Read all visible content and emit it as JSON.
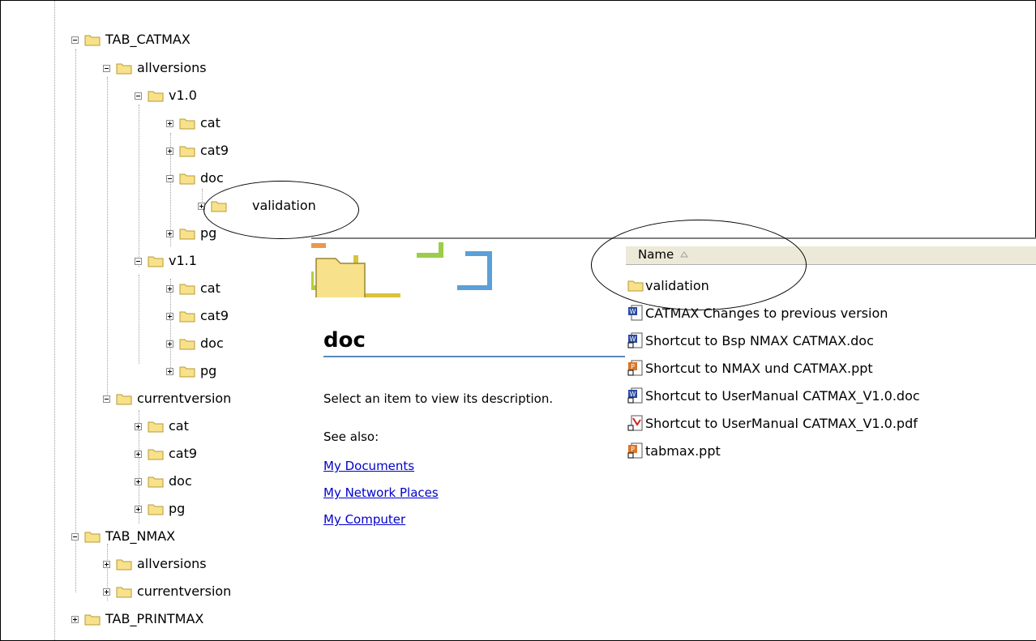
{
  "tree": {
    "nodes": [
      {
        "label": "TAB_CATMAX",
        "expanded": true
      },
      {
        "label": "allversions",
        "expanded": true
      },
      {
        "label": "v1.0",
        "expanded": true
      },
      {
        "label": "cat",
        "expanded": false
      },
      {
        "label": "cat9",
        "expanded": false
      },
      {
        "label": "doc",
        "expanded": true
      },
      {
        "label": "validation",
        "expanded": false
      },
      {
        "label": "pg",
        "expanded": false
      },
      {
        "label": "v1.1",
        "expanded": true
      },
      {
        "label": "cat",
        "expanded": false
      },
      {
        "label": "cat9",
        "expanded": false
      },
      {
        "label": "doc",
        "expanded": false
      },
      {
        "label": "pg",
        "expanded": false
      },
      {
        "label": "currentversion",
        "expanded": true
      },
      {
        "label": "cat",
        "expanded": false
      },
      {
        "label": "cat9",
        "expanded": false
      },
      {
        "label": "doc",
        "expanded": false
      },
      {
        "label": "pg",
        "expanded": false
      },
      {
        "label": "TAB_NMAX",
        "expanded": true
      },
      {
        "label": "allversions",
        "expanded": false
      },
      {
        "label": "currentversion",
        "expanded": false
      },
      {
        "label": "TAB_PRINTMAX",
        "expanded": false
      }
    ]
  },
  "task_pane": {
    "folder_title": "doc",
    "description": "Select an item to view its description.",
    "see_also_label": "See also:",
    "links": [
      "My Documents",
      "My Network Places",
      "My Computer"
    ]
  },
  "file_list": {
    "column_header": "Name",
    "sort": "ascending",
    "items": [
      {
        "name": "validation",
        "icon": "folder-icon"
      },
      {
        "name": "CATMAX Changes to previous version",
        "icon": "word-document-icon"
      },
      {
        "name": "Shortcut to Bsp NMAX CATMAX.doc",
        "icon": "word-shortcut-icon"
      },
      {
        "name": "Shortcut to NMAX und CATMAX.ppt",
        "icon": "powerpoint-shortcut-icon"
      },
      {
        "name": "Shortcut to UserManual CATMAX_V1.0.doc",
        "icon": "word-shortcut-icon"
      },
      {
        "name": "Shortcut to UserManual CATMAX_V1.0.pdf",
        "icon": "pdf-shortcut-icon"
      },
      {
        "name": "tabmax.ppt",
        "icon": "powerpoint-shortcut-icon"
      }
    ]
  },
  "colors": {
    "folder_fill": "#f7e28b",
    "folder_edge": "#b89a32",
    "link": "#0000cc",
    "header_bg": "#ece9d8",
    "title_rule": "#5b89b9"
  }
}
